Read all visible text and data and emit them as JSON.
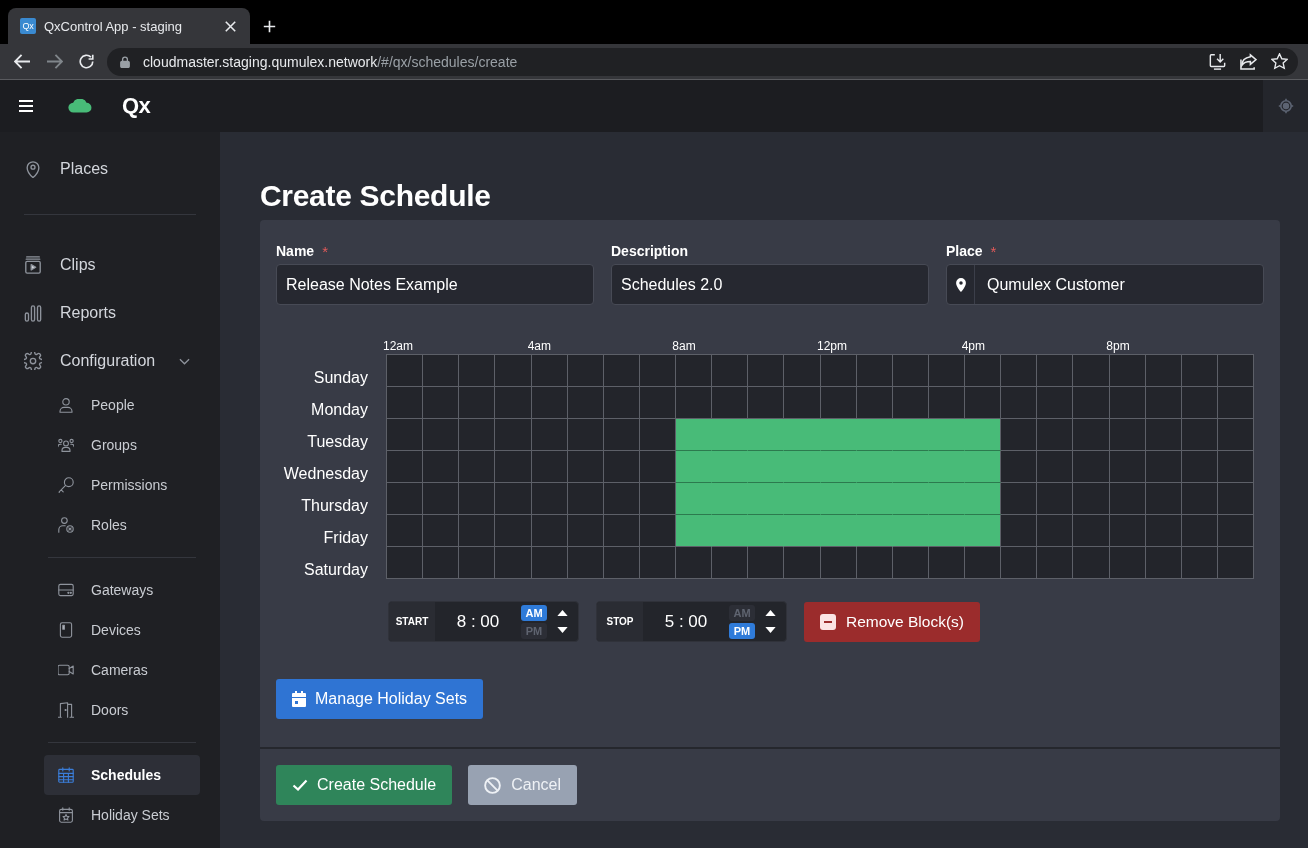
{
  "browser": {
    "tab": {
      "favicon": "Qx",
      "title": "QxControl App - staging"
    },
    "forward_disabled": true,
    "url": {
      "host": "cloudmaster.staging.qumulex.network",
      "path": "/#/qx/schedules/create"
    }
  },
  "header": {
    "brand": "Qx"
  },
  "sidebar": {
    "items": [
      {
        "label": "Places",
        "selected": false,
        "divider_after": true
      },
      {
        "label": "Clips",
        "selected": false,
        "divider_after": false
      },
      {
        "label": "Reports",
        "selected": false,
        "divider_after": false
      },
      {
        "label": "Configuration",
        "selected": false,
        "divider_after": false,
        "expanded": true,
        "children": [
          {
            "label": "People",
            "selected": false,
            "divider_after": false
          },
          {
            "label": "Groups",
            "selected": false,
            "divider_after": false
          },
          {
            "label": "Permissions",
            "selected": false,
            "divider_after": false
          },
          {
            "label": "Roles",
            "selected": false,
            "divider_after": true
          },
          {
            "label": "Gateways",
            "selected": false,
            "divider_after": false
          },
          {
            "label": "Devices",
            "selected": false,
            "divider_after": false
          },
          {
            "label": "Cameras",
            "selected": false,
            "divider_after": false
          },
          {
            "label": "Doors",
            "selected": false,
            "divider_after": true
          },
          {
            "label": "Schedules",
            "selected": true,
            "divider_after": false
          },
          {
            "label": "Holiday Sets",
            "selected": false,
            "divider_after": false
          }
        ]
      }
    ]
  },
  "page": {
    "title": "Create Schedule"
  },
  "form": {
    "fields": [
      {
        "kind": "text",
        "label": "Name",
        "required_mark": "*",
        "value": "Release Notes Example"
      },
      {
        "kind": "text",
        "label": "Description",
        "value": "Schedules 2.0"
      },
      {
        "kind": "place",
        "label": "Place",
        "required_mark": "*",
        "value": "Qumulex Customer"
      }
    ]
  },
  "schedule": {
    "hour_labels": [
      "12am",
      "4am",
      "8am",
      "12pm",
      "4pm",
      "8pm"
    ],
    "days": [
      {
        "label": "Sunday",
        "cells": [
          false,
          false,
          false,
          false,
          false,
          false,
          false,
          false,
          false,
          false,
          false,
          false,
          false,
          false,
          false,
          false,
          false,
          false,
          false,
          false,
          false,
          false,
          false,
          false
        ]
      },
      {
        "label": "Monday",
        "cells": [
          false,
          false,
          false,
          false,
          false,
          false,
          false,
          false,
          false,
          false,
          false,
          false,
          false,
          false,
          false,
          false,
          false,
          false,
          false,
          false,
          false,
          false,
          false,
          false
        ]
      },
      {
        "label": "Tuesday",
        "cells": [
          false,
          false,
          false,
          false,
          false,
          false,
          false,
          false,
          true,
          true,
          true,
          true,
          true,
          true,
          true,
          true,
          true,
          false,
          false,
          false,
          false,
          false,
          false,
          false
        ]
      },
      {
        "label": "Wednesday",
        "cells": [
          false,
          false,
          false,
          false,
          false,
          false,
          false,
          false,
          true,
          true,
          true,
          true,
          true,
          true,
          true,
          true,
          true,
          false,
          false,
          false,
          false,
          false,
          false,
          false
        ]
      },
      {
        "label": "Thursday",
        "cells": [
          false,
          false,
          false,
          false,
          false,
          false,
          false,
          false,
          true,
          true,
          true,
          true,
          true,
          true,
          true,
          true,
          true,
          false,
          false,
          false,
          false,
          false,
          false,
          false
        ]
      },
      {
        "label": "Friday",
        "cells": [
          false,
          false,
          false,
          false,
          false,
          false,
          false,
          false,
          true,
          true,
          true,
          true,
          true,
          true,
          true,
          true,
          true,
          false,
          false,
          false,
          false,
          false,
          false,
          false
        ]
      },
      {
        "label": "Saturday",
        "cells": [
          false,
          false,
          false,
          false,
          false,
          false,
          false,
          false,
          false,
          false,
          false,
          false,
          false,
          false,
          false,
          false,
          false,
          false,
          false,
          false,
          false,
          false,
          false,
          false
        ]
      }
    ]
  },
  "time_controls": [
    {
      "label": "START",
      "value": "8 : 00",
      "periods": [
        {
          "label": "AM",
          "selected": true
        },
        {
          "label": "PM",
          "selected": false
        }
      ]
    },
    {
      "label": "STOP",
      "value": "5 : 00",
      "periods": [
        {
          "label": "AM",
          "selected": false
        },
        {
          "label": "PM",
          "selected": true
        }
      ]
    }
  ],
  "remove_button": {
    "label": "Remove Block(s)"
  },
  "holiday_button": {
    "label": "Manage Holiday Sets"
  },
  "footer_buttons": [
    {
      "kind": "primary",
      "label": "Create Schedule"
    },
    {
      "kind": "secondary",
      "label": "Cancel"
    }
  ]
}
